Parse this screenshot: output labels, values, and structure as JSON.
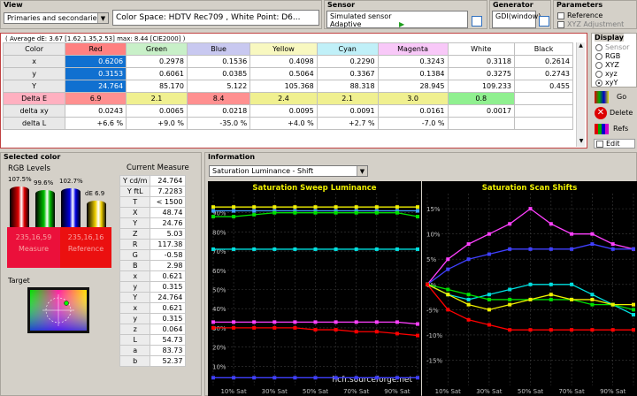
{
  "view": {
    "title": "View",
    "selector": "Primaries and secondaries",
    "colorspace": "Color Space: HDTV Rec709 , White Point: D6..."
  },
  "sensor": {
    "title": "Sensor",
    "line1": "Simulated sensor",
    "line2": "Adaptive"
  },
  "generator": {
    "title": "Generator",
    "value": "GDI(window)"
  },
  "parameters": {
    "title": "Parameters",
    "reference": "Reference",
    "xyz_adjust": "XYZ Adjustment"
  },
  "summary": "( Average dE: 3.67 [1.62,1.35,2.53] max: 8.44 [CIE2000] )",
  "table": {
    "corner": "Color",
    "cols": [
      "Red",
      "Green",
      "Blue",
      "Yellow",
      "Cyan",
      "Magenta",
      "White",
      "Black"
    ],
    "col_colors": [
      "#ff8080",
      "#c8f0c8",
      "#c8c8f0",
      "#f8f8c0",
      "#c0f0f8",
      "#f8c8f8",
      "#ffffff",
      "#ffffff"
    ],
    "rows": [
      {
        "label": "x",
        "cells": [
          "0.6206",
          "0.2978",
          "0.1536",
          "0.4098",
          "0.2290",
          "0.3243",
          "0.3118",
          "0.2614"
        ]
      },
      {
        "label": "y",
        "cells": [
          "0.3153",
          "0.6061",
          "0.0385",
          "0.5064",
          "0.3367",
          "0.1384",
          "0.3275",
          "0.2743"
        ]
      },
      {
        "label": "Y",
        "cells": [
          "24.764",
          "85.170",
          "5.122",
          "105.368",
          "88.318",
          "28.945",
          "109.233",
          "0.455"
        ]
      },
      {
        "label": "Delta E",
        "cells": [
          "6.9",
          "2.1",
          "8.4",
          "2.4",
          "2.1",
          "3.0",
          "0.8",
          ""
        ]
      },
      {
        "label": "delta xy",
        "cells": [
          "0.0243",
          "0.0065",
          "0.0218",
          "0.0095",
          "0.0091",
          "0.0161",
          "0.0017",
          ""
        ]
      },
      {
        "label": "delta L",
        "cells": [
          "+6.6 %",
          "+9.0 %",
          "-35.0 %",
          "+4.0 %",
          "+2.7 %",
          "-7.0 %",
          "",
          ""
        ]
      }
    ],
    "de_colors": [
      "#ff9090",
      "#f0f090",
      "#ff9090",
      "#f0f090",
      "#f0f090",
      "#f0f090",
      "#90f090",
      "#ffffff"
    ]
  },
  "display": {
    "title": "Display",
    "options": [
      "Sensor",
      "RGB",
      "XYZ",
      "xyz",
      "xyY"
    ],
    "selected": "xyY"
  },
  "actions": {
    "go": "Go",
    "delete": "Delete",
    "refs": "Refs",
    "edit": "Edit"
  },
  "selected": {
    "title": "Selected color",
    "rgb_title": "RGB Levels",
    "bars": [
      {
        "label": "107.5%",
        "level": 1.0,
        "color": "#e00000"
      },
      {
        "label": "99.6%",
        "level": 0.93,
        "color": "#00c000"
      },
      {
        "label": "102.7%",
        "level": 0.96,
        "color": "#0000e0"
      },
      {
        "label": "dE 6.9",
        "level": 0.72,
        "color": "#f0d000"
      }
    ],
    "measure_label": "Measure",
    "measure_value": "235,16,59",
    "reference_label": "Reference",
    "reference_value": "235,16,16",
    "target_label": "Target"
  },
  "current": {
    "title": "Current Measure",
    "rows": [
      [
        "Y cd/m",
        "24.764"
      ],
      [
        "Y ftL",
        "7.2283"
      ],
      [
        "T",
        "< 1500"
      ],
      [
        "X",
        "48.74"
      ],
      [
        "Y",
        "24.76"
      ],
      [
        "Z",
        "5.03"
      ],
      [
        "R",
        "117.38"
      ],
      [
        "G",
        "-0.58"
      ],
      [
        "B",
        "2.98"
      ],
      [
        "x",
        "0.621"
      ],
      [
        "y",
        "0.315"
      ],
      [
        "Y",
        "24.764"
      ],
      [
        "x",
        "0.621"
      ],
      [
        "y",
        "0.315"
      ],
      [
        "z",
        "0.064"
      ],
      [
        "L",
        "54.73"
      ],
      [
        "a",
        "83.73"
      ],
      [
        "b",
        "52.37"
      ]
    ]
  },
  "information": {
    "title": "Information",
    "selector": "Saturation Luminance - Shift"
  },
  "chart_data": [
    {
      "type": "line",
      "title": "Saturation Sweep Luminance",
      "x": [
        "0% Sat",
        "10% Sat",
        "20% Sat",
        "30% Sat",
        "40% Sat",
        "50% Sat",
        "60% Sat",
        "70% Sat",
        "80% Sat",
        "90% Sat",
        "100% Sat"
      ],
      "xticks": [
        "10% Sat",
        "30% Sat",
        "50% Sat",
        "70% Sat",
        "90% Sat"
      ],
      "yticks": [
        "90%",
        "80%",
        "70%",
        "60%",
        "50%",
        "40%",
        "30%",
        "20%",
        "10%"
      ],
      "ylim": [
        0,
        100
      ],
      "grid": true,
      "watermark": "hcfr.sourceforge.net",
      "series": [
        {
          "color": "#f0f000",
          "values": [
            93,
            93,
            93,
            93,
            93,
            93,
            93,
            93,
            93,
            93,
            93
          ]
        },
        {
          "color": "#40a0ff",
          "values": [
            91,
            91,
            91,
            91,
            91,
            91,
            91,
            91,
            91,
            91,
            91
          ]
        },
        {
          "color": "#00e000",
          "values": [
            88,
            88,
            89,
            90,
            90,
            90,
            90,
            90,
            90,
            90,
            88
          ]
        },
        {
          "color": "#00e0e0",
          "values": [
            71,
            71,
            71,
            71,
            71,
            71,
            71,
            71,
            71,
            71,
            71
          ]
        },
        {
          "color": "#ff40ff",
          "values": [
            33,
            33,
            33,
            33,
            33,
            33,
            33,
            33,
            33,
            33,
            32
          ]
        },
        {
          "color": "#ff0000",
          "values": [
            30,
            30,
            30,
            30,
            30,
            29,
            29,
            28,
            28,
            27,
            26
          ]
        },
        {
          "color": "#4040ff",
          "values": [
            4,
            4,
            4,
            4,
            4,
            4,
            4,
            4,
            4,
            4,
            4
          ]
        }
      ]
    },
    {
      "type": "line",
      "title": "Saturation Scan Shifts",
      "x": [
        "0% Sat",
        "10% Sat",
        "20% Sat",
        "30% Sat",
        "40% Sat",
        "50% Sat",
        "60% Sat",
        "70% Sat",
        "80% Sat",
        "90% Sat",
        "100% Sat"
      ],
      "xticks": [
        "10% Sat",
        "30% Sat",
        "50% Sat",
        "70% Sat",
        "90% Sat"
      ],
      "yticks": [
        "15%",
        "10%",
        "5%",
        "0%",
        "-5%",
        "-10%",
        "-15%"
      ],
      "ylim": [
        -20,
        18
      ],
      "grid": true,
      "series": [
        {
          "color": "#ff40ff",
          "values": [
            0,
            5,
            8,
            10,
            12,
            15,
            12,
            10,
            10,
            8,
            7
          ]
        },
        {
          "color": "#4040ff",
          "values": [
            0,
            3,
            5,
            6,
            7,
            7,
            7,
            7,
            8,
            7,
            7
          ]
        },
        {
          "color": "#00e0e0",
          "values": [
            0,
            -2,
            -3,
            -2,
            -1,
            0,
            0,
            0,
            -2,
            -4,
            -6
          ]
        },
        {
          "color": "#00e000",
          "values": [
            0,
            -1,
            -2,
            -3,
            -3,
            -3,
            -3,
            -3,
            -4,
            -4,
            -5
          ]
        },
        {
          "color": "#f0f000",
          "values": [
            0,
            -2,
            -4,
            -5,
            -4,
            -3,
            -2,
            -3,
            -3,
            -4,
            -4
          ]
        },
        {
          "color": "#ff0000",
          "values": [
            0,
            -5,
            -7,
            -8,
            -9,
            -9,
            -9,
            -9,
            -9,
            -9,
            -9
          ]
        }
      ]
    }
  ]
}
